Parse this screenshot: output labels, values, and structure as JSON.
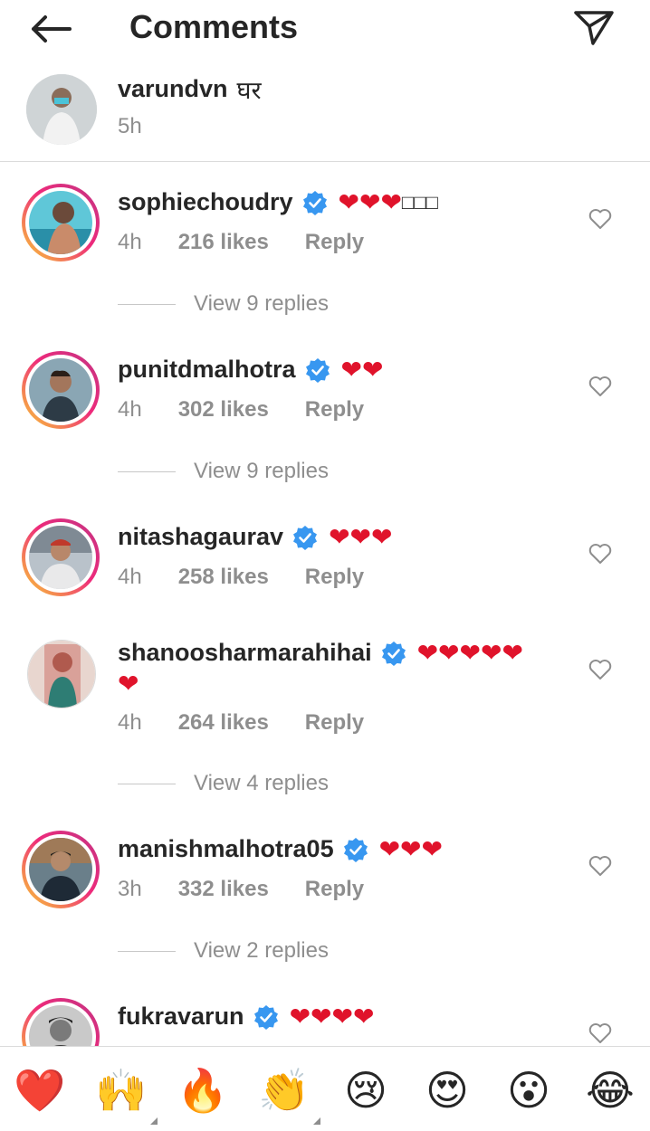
{
  "header": {
    "title": "Comments",
    "back_icon": "back-arrow-icon",
    "share_icon": "send-icon"
  },
  "caption": {
    "username": "varundvn",
    "text": "घर",
    "time": "5h"
  },
  "comments": [
    {
      "username": "sophiechoudry",
      "verified": true,
      "text": "❤❤❤",
      "extra": "□□□",
      "time": "4h",
      "likes": "216 likes",
      "reply": "Reply",
      "view_replies": "View 9 replies",
      "ring": true,
      "avatar_colors": [
        "#5fc7d8",
        "#2a8fa8",
        "#c98b6a"
      ]
    },
    {
      "username": "punitdmalhotra",
      "verified": true,
      "text": "❤❤",
      "time": "4h",
      "likes": "302 likes",
      "reply": "Reply",
      "view_replies": "View 9 replies",
      "ring": true,
      "avatar_colors": [
        "#8aa6b4",
        "#2d3b46",
        "#5a4a3e"
      ]
    },
    {
      "username": "nitashagaurav",
      "verified": true,
      "text": "❤❤❤",
      "time": "4h",
      "likes": "258 likes",
      "reply": "Reply",
      "view_replies": "",
      "ring": true,
      "avatar_colors": [
        "#b9c2ca",
        "#e9e9ea",
        "#c0392b"
      ]
    },
    {
      "username": "shanoosharmarahihai",
      "verified": true,
      "text": "❤❤❤❤❤",
      "text2": "❤",
      "time": "4h",
      "likes": "264 likes",
      "reply": "Reply",
      "view_replies": "View 4 replies",
      "ring": false,
      "avatar_colors": [
        "#d9a199",
        "#b05a4e",
        "#2e7d74"
      ]
    },
    {
      "username": "manishmalhotra05",
      "verified": true,
      "text": "❤❤❤",
      "time": "3h",
      "likes": "332 likes",
      "reply": "Reply",
      "view_replies": "View 2 replies",
      "ring": true,
      "avatar_colors": [
        "#6a7f8a",
        "#1e2a36",
        "#9f7a58"
      ]
    },
    {
      "username": "fukravarun",
      "verified": true,
      "text": "❤❤❤❤",
      "ring": true,
      "avatar_colors": [
        "#c9c9c9",
        "#3b3b3b",
        "#7a7a7a"
      ]
    }
  ],
  "emoji_bar": [
    {
      "glyph": "❤️",
      "name": "red-heart-emoji"
    },
    {
      "glyph": "🙌",
      "name": "raising-hands-emoji",
      "variants": true
    },
    {
      "glyph": "🔥",
      "name": "fire-emoji"
    },
    {
      "glyph": "👏",
      "name": "clapping-hands-emoji",
      "variants": true
    },
    {
      "glyph": "😢",
      "name": "crying-face-emoji"
    },
    {
      "glyph": "😍",
      "name": "heart-eyes-emoji"
    },
    {
      "glyph": "😮",
      "name": "surprised-face-emoji"
    },
    {
      "glyph": "😂",
      "name": "tears-of-joy-emoji"
    }
  ],
  "colors": {
    "text": "#262626",
    "secondary": "#8e8e8e",
    "verified": "#3897f0",
    "heart": "#e0132b"
  }
}
